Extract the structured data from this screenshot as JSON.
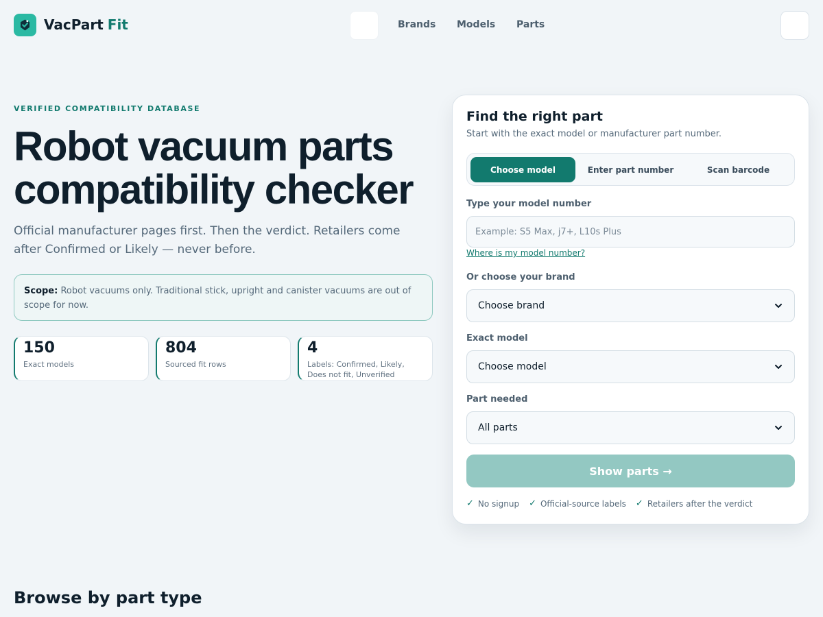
{
  "header": {
    "brand_primary": "VacPart",
    "brand_accent": "Fit",
    "nav": [
      {
        "label": "Brands"
      },
      {
        "label": "Models"
      },
      {
        "label": "Parts"
      }
    ]
  },
  "hero": {
    "eyebrow": "VERIFIED COMPATIBILITY DATABASE",
    "title": "Robot vacuum parts compatibility checker",
    "subtitle": "Official manufacturer pages first. Then the verdict. Retailers come after Confirmed or Likely — never before.",
    "scope_label": "Scope:",
    "scope_text": "Robot vacuums only. Traditional stick, upright and canister vacuums are out of scope for now.",
    "stats": [
      {
        "value": "150",
        "label": "Exact models"
      },
      {
        "value": "804",
        "label": "Sourced fit rows"
      },
      {
        "value": "4",
        "label": "Labels: Confirmed, Likely, Does not fit, Unverified"
      }
    ]
  },
  "finder": {
    "title": "Find the right part",
    "subtitle": "Start with the exact model or manufacturer part number.",
    "tabs": [
      {
        "label": "Choose model",
        "active": true
      },
      {
        "label": "Enter part number",
        "active": false
      },
      {
        "label": "Scan barcode",
        "active": false
      }
    ],
    "model_number_label": "Type your model number",
    "model_number_value": "",
    "model_number_placeholder": "Example: S5 Max, j7+, L10s Plus",
    "help_link": "Where is my model number?",
    "brand_label": "Or choose your brand",
    "brand_selected": "Choose brand",
    "model_label": "Exact model",
    "model_selected": "Choose model",
    "part_label": "Part needed",
    "part_selected": "All parts",
    "submit_label": "Show parts →",
    "assurances": [
      "No signup",
      "Official-source labels",
      "Retailers after the verdict"
    ]
  },
  "browse": {
    "title": "Browse by part type"
  },
  "colors": {
    "accent": "#127a6e",
    "logo": "#2bb9a3",
    "button_disabled": "#93c8c2",
    "background": "#f1f5f8"
  },
  "icons": {
    "logo": "check-badge-icon",
    "select": "chevron-down-icon",
    "check": "checkmark-icon"
  }
}
